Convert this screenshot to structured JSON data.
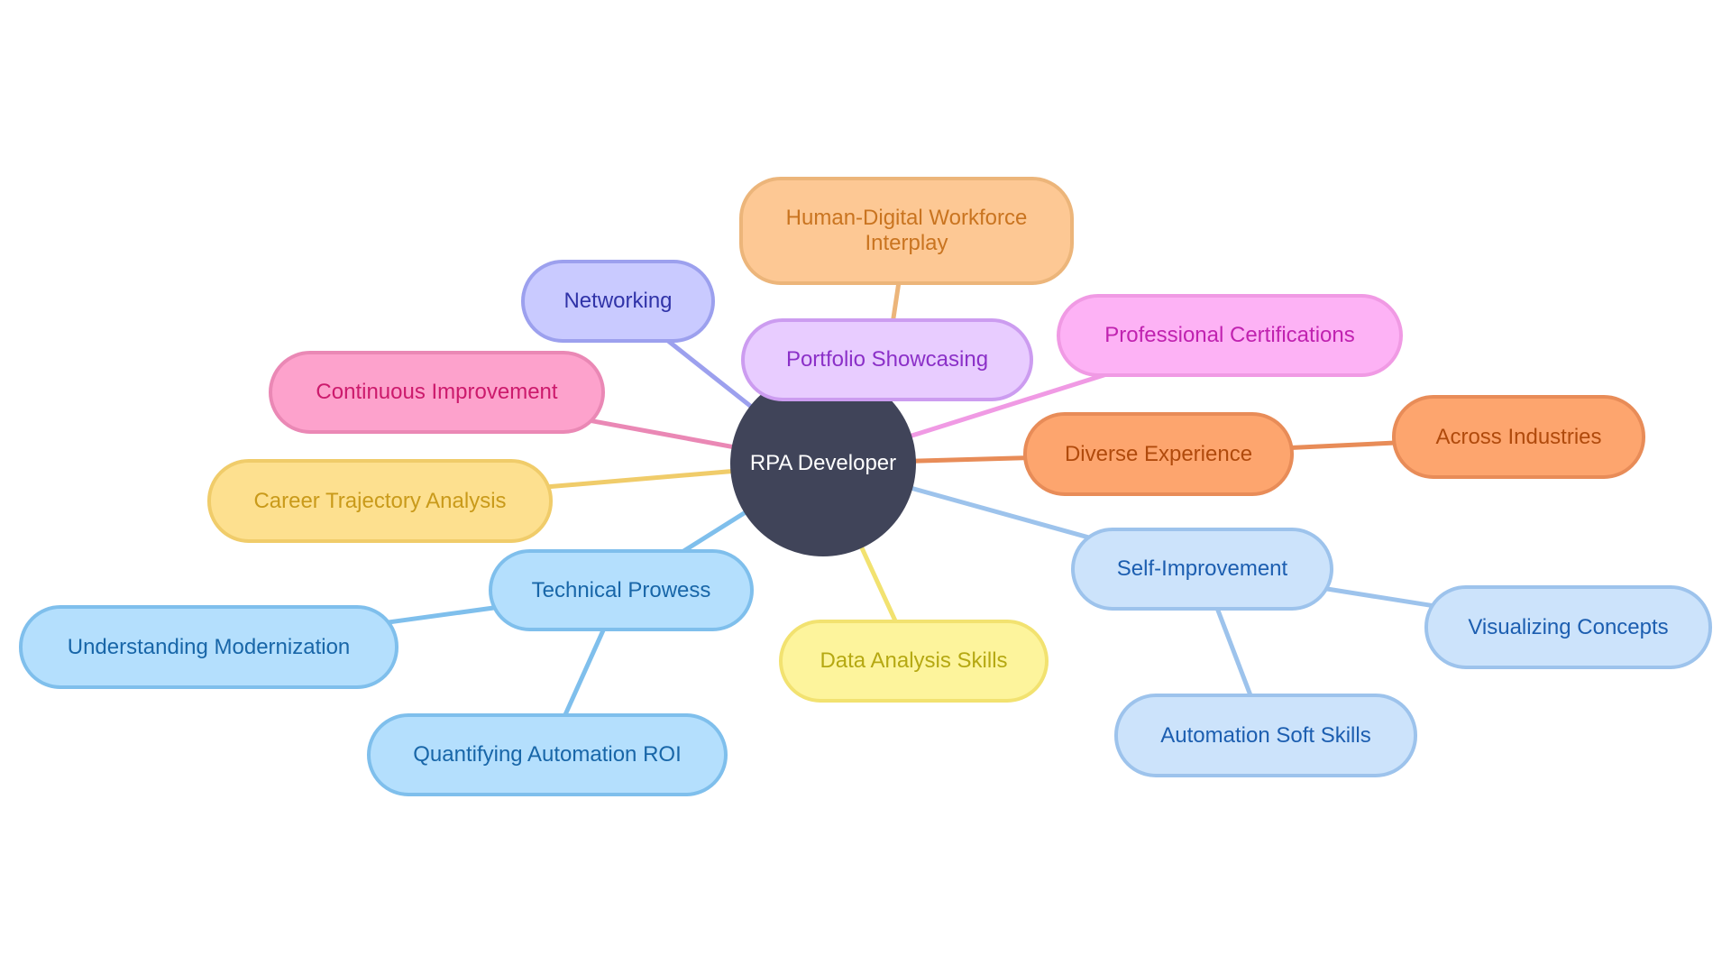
{
  "diagram": {
    "type": "mindmap",
    "root": {
      "id": "root",
      "label": "RPA Developer",
      "fill": "#404459",
      "text": "#ffffff"
    },
    "nodes": [
      {
        "id": "networking",
        "label": "Networking",
        "parent": "root",
        "fill": "#c9caff",
        "stroke": "#9ca0ee",
        "text": "#3033a8"
      },
      {
        "id": "portfolio",
        "label": "Portfolio Showcasing",
        "parent": "root",
        "fill": "#e8ccff",
        "stroke": "#cc9cf0",
        "text": "#8b30c8"
      },
      {
        "id": "human-digital",
        "label": "Human-Digital Workforce Interplay",
        "parent": "portfolio",
        "fill": "#fdc894",
        "stroke": "#ecb57a",
        "text": "#c97420",
        "edge": "#ecb57a"
      },
      {
        "id": "professional",
        "label": "Professional Certifications",
        "parent": "root",
        "fill": "#fdb2f5",
        "stroke": "#f09ae4",
        "text": "#c022b0"
      },
      {
        "id": "continuous",
        "label": "Continuous Improvement",
        "parent": "root",
        "fill": "#fda2cc",
        "stroke": "#ea88b5",
        "text": "#cc1a6c"
      },
      {
        "id": "career",
        "label": "Career Trajectory Analysis",
        "parent": "root",
        "fill": "#fde08f",
        "stroke": "#f0cc6a",
        "text": "#c99a1a"
      },
      {
        "id": "diverse",
        "label": "Diverse Experience",
        "parent": "root",
        "fill": "#fda56e",
        "stroke": "#e88c58",
        "text": "#b04a0c"
      },
      {
        "id": "across",
        "label": "Across Industries",
        "parent": "diverse",
        "fill": "#fda56e",
        "stroke": "#e88c58",
        "text": "#b04a0c"
      },
      {
        "id": "technical",
        "label": "Technical Prowess",
        "parent": "root",
        "fill": "#b4dffd",
        "stroke": "#7fbfec",
        "text": "#1866a8"
      },
      {
        "id": "understanding",
        "label": "Understanding Modernization",
        "parent": "technical",
        "fill": "#b4dffd",
        "stroke": "#7fbfec",
        "text": "#1866a8"
      },
      {
        "id": "quantifying",
        "label": "Quantifying Automation ROI",
        "parent": "technical",
        "fill": "#b4dffd",
        "stroke": "#7fbfec",
        "text": "#1866a8"
      },
      {
        "id": "data-analysis",
        "label": "Data Analysis Skills",
        "parent": "root",
        "fill": "#fdf49c",
        "stroke": "#f2e270",
        "text": "#b5a812"
      },
      {
        "id": "self-improvement",
        "label": "Self-Improvement",
        "parent": "root",
        "fill": "#cce3fb",
        "stroke": "#9dc3ec",
        "text": "#1c5eb0"
      },
      {
        "id": "visualizing",
        "label": "Visualizing Concepts",
        "parent": "self-improvement",
        "fill": "#cce3fb",
        "stroke": "#9dc3ec",
        "text": "#1c5eb0"
      },
      {
        "id": "automation-soft",
        "label": "Automation Soft Skills",
        "parent": "self-improvement",
        "fill": "#cce3fb",
        "stroke": "#9dc3ec",
        "text": "#1c5eb0"
      }
    ]
  }
}
